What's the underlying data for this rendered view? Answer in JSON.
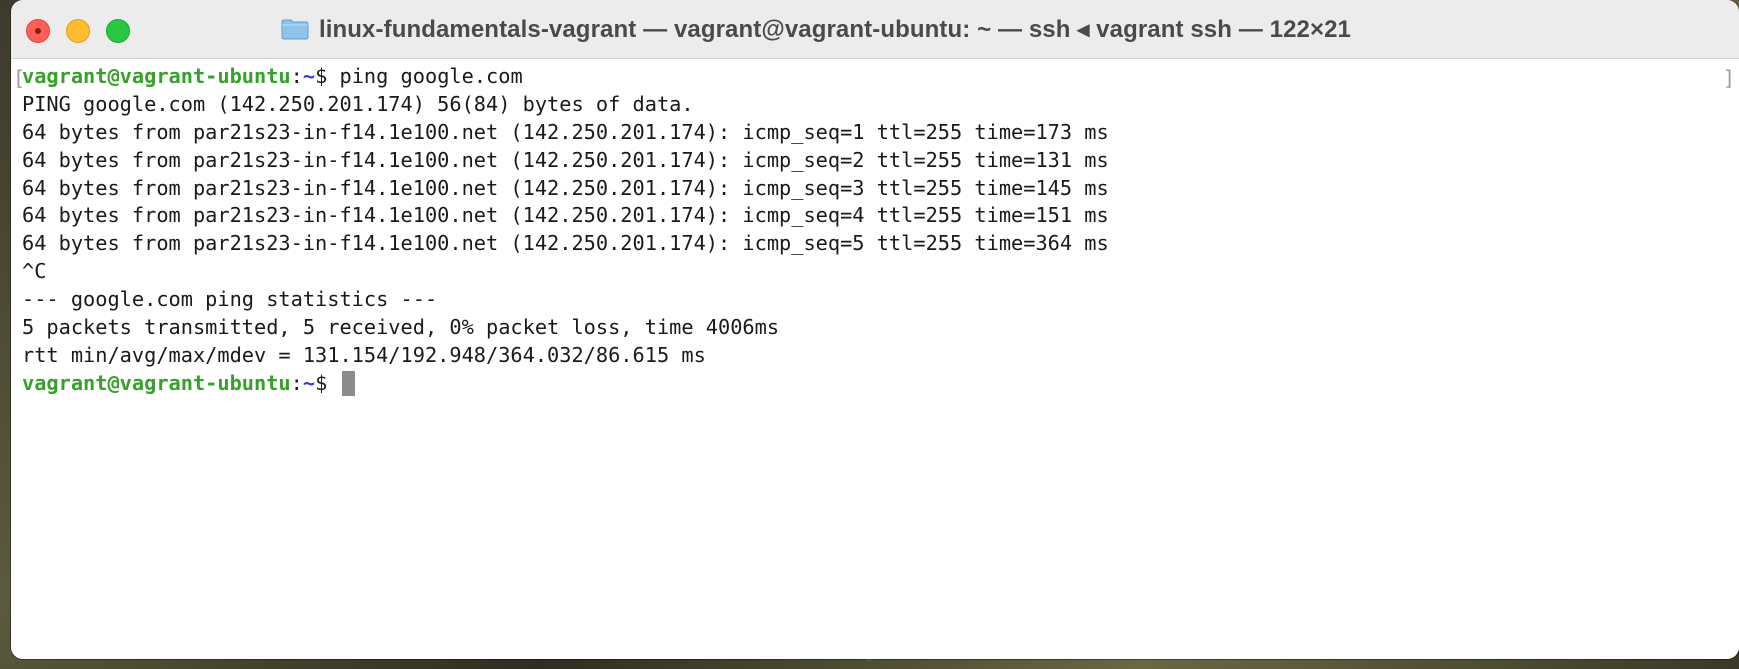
{
  "window": {
    "title": "linux-fundamentals-vagrant — vagrant@vagrant-ubuntu: ~ — ssh ◂ vagrant ssh — 122×21",
    "folder_icon": "folder-icon",
    "controls": {
      "close": "close-icon",
      "minimize": "minimize-icon",
      "zoom": "zoom-icon"
    }
  },
  "colors": {
    "prompt_user": "#37a12b",
    "prompt_path": "#3b3bd9",
    "close": "#ff5f57",
    "minimize": "#febc2e",
    "zoom": "#28c840"
  },
  "terminal": {
    "prompt_user_host": "vagrant@vagrant-ubuntu",
    "prompt_colon": ":",
    "prompt_path": "~",
    "prompt_symbol": "$",
    "command": " ping google.com",
    "output": [
      "PING google.com (142.250.201.174) 56(84) bytes of data.",
      "64 bytes from par21s23-in-f14.1e100.net (142.250.201.174): icmp_seq=1 ttl=255 time=173 ms",
      "64 bytes from par21s23-in-f14.1e100.net (142.250.201.174): icmp_seq=2 ttl=255 time=131 ms",
      "64 bytes from par21s23-in-f14.1e100.net (142.250.201.174): icmp_seq=3 ttl=255 time=145 ms",
      "64 bytes from par21s23-in-f14.1e100.net (142.250.201.174): icmp_seq=4 ttl=255 time=151 ms",
      "64 bytes from par21s23-in-f14.1e100.net (142.250.201.174): icmp_seq=5 ttl=255 time=364 ms",
      "^C",
      "--- google.com ping statistics ---",
      "5 packets transmitted, 5 received, 0% packet loss, time 4006ms",
      "rtt min/avg/max/mdev = 131.154/192.948/364.032/86.615 ms"
    ],
    "final_prompt_user_host": "vagrant@vagrant-ubuntu",
    "final_prompt_colon": ":",
    "final_prompt_path": "~",
    "final_prompt_symbol": "$",
    "bracket_left": "[",
    "bracket_right": "]"
  }
}
